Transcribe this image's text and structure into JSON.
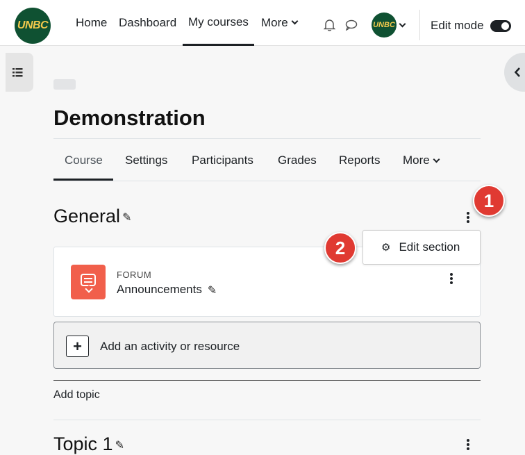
{
  "header": {
    "logo_text": "UNBC",
    "nav": [
      "Home",
      "Dashboard",
      "My courses",
      "More"
    ],
    "active_nav": "My courses",
    "user_initials": "UNBC",
    "edit_mode_label": "Edit mode",
    "edit_mode_on": true
  },
  "course": {
    "title": "Demonstration",
    "tabs": [
      "Course",
      "Settings",
      "Participants",
      "Grades",
      "Reports",
      "More"
    ],
    "active_tab": "Course"
  },
  "sections": [
    {
      "title": "General",
      "activities": [
        {
          "type": "FORUM",
          "name": "Announcements"
        }
      ]
    },
    {
      "title": "Topic 1"
    }
  ],
  "section_menu": {
    "item": "Edit section"
  },
  "callouts": [
    "1",
    "2"
  ],
  "add_activity_label": "Add an activity or resource",
  "add_topic_label": "Add topic",
  "colors": {
    "brand_green": "#0f5132",
    "brand_gold": "#f2c94c",
    "forum_icon": "#f15f4b",
    "callout_red": "#e03a32"
  }
}
